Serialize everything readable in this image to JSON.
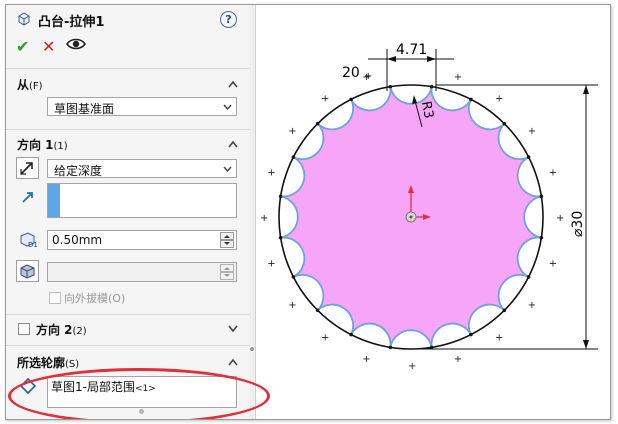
{
  "feature": {
    "title": "凸台-拉伸1",
    "help_label": "?"
  },
  "toolbar": {
    "ok_label": "✔",
    "cancel_label": "✕"
  },
  "from_section": {
    "title": "从",
    "hotkey": "(F)",
    "start_condition": "草图基准面"
  },
  "direction1": {
    "title": "方向 1",
    "hotkey": "(1)",
    "end_condition": "给定深度",
    "depth_value": "0.50mm",
    "draft_spin_value": "",
    "draft_outward_label": "向外拔模(O)"
  },
  "direction2": {
    "title": "方向 2",
    "hotkey": "(2)"
  },
  "selected_contours": {
    "title": "所选轮廓",
    "hotkey": "(S)",
    "item": "草图1-局部范围",
    "item_suffix": "<1>"
  },
  "sketch": {
    "dim_width": "4.71",
    "dim_radius": "R3",
    "dim_diameter": "⌀30",
    "pattern_count": "20",
    "fill_color": "#f7a6f7",
    "scallop_color": "#6fa2d8",
    "origin_color": "#e0303a"
  }
}
